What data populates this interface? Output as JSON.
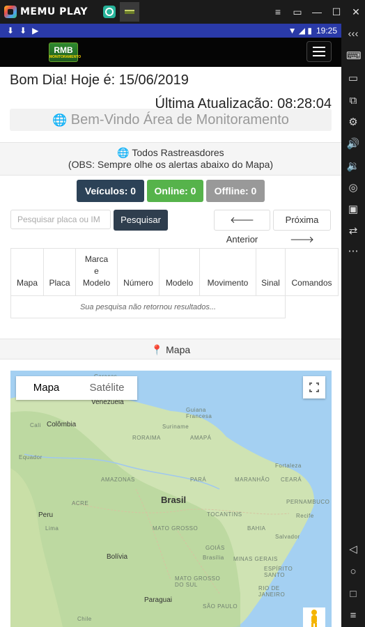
{
  "emulator": {
    "brand": "MEMU PLAY",
    "window_controls": [
      "≡",
      "▭",
      "—",
      "☐",
      "✕"
    ],
    "side_icons": [
      "expand-icon",
      "keyboard-icon",
      "screen-icon",
      "copy-icon",
      "settings-icon",
      "volume-up-icon",
      "volume-down-icon",
      "location-icon",
      "folder-icon",
      "rotate-icon",
      "more-icon",
      "back-icon",
      "home-icon",
      "recents-icon",
      "menu-icon"
    ],
    "side_glyphs": [
      "‹‹‹",
      "⌨",
      "▭",
      "⧉",
      "⚙",
      "🔊",
      "🔉",
      "◎",
      "▣",
      "⇄",
      "⋯",
      "◁",
      "○",
      "□",
      "≡"
    ],
    "side_top": "‹‹‹"
  },
  "statusbar": {
    "left_icons": [
      "⬇",
      "⬇",
      "▶"
    ],
    "time": "19:25",
    "icons": "▼ ◢ ▮"
  },
  "app": {
    "logo": "RMB",
    "logo_sub": "MONITORAMENTO"
  },
  "content": {
    "greeting": "Bom Dia! Hoje é: 15/06/2019",
    "last_update": "Última Atualização: 08:28:04",
    "welcome": "Bem-Vindo Área de Monitoramento",
    "panel_title": "Todos Rastreasdores",
    "panel_note": "(OBS: Sempre olhe os alertas abaixo do Mapa)",
    "counters": {
      "vehicles": "Veículos: 0",
      "online": "Online: 0",
      "offline": "Offline: 0"
    },
    "search_placeholder": "Pesquisar placa ou IM",
    "search_button": "Pesquisar",
    "prev_button": "Anterior",
    "next_button": "Próxima",
    "table_headers": [
      "Mapa",
      "Placa",
      "Marca\ne\nModelo",
      "Número",
      "Modelo",
      "Movimento",
      "Sinal",
      "Comandos"
    ],
    "empty_message": "Sua pesquisa não retornou resultados...",
    "map_section": "Mapa"
  },
  "map": {
    "tab_map": "Mapa",
    "tab_satellite": "Satélite",
    "labels": {
      "caracas": "Caracas",
      "venezuela": "Venezuela",
      "guiana": "Guiana\nFrancesa",
      "cali": "Cali",
      "colombia": "Colômbia",
      "suriname": "Suriname",
      "amapa": "AMAPÁ",
      "roraima": "RORAIMA",
      "equador": "Equador",
      "fortaleza": "Fortaleza",
      "amazonas": "AMAZONAS",
      "para": "PARÁ",
      "maranhao": "MARANHÃO",
      "ceara": "CEARÁ",
      "brasil": "Brasil",
      "acre": "ACRE",
      "pernambuco": "PERNAMBUCO",
      "peru": "Peru",
      "lima": "Lima",
      "tocantins": "TOCANTINS",
      "recife": "Recife",
      "matogrosso": "MATO GROSSO",
      "bahia": "BAHIA",
      "salvador": "Salvador",
      "bolivia": "Bolívia",
      "goias": "GOIÁS",
      "brasilia": "Brasília",
      "minas": "MINAS GERAIS",
      "ms": "MATO GROSSO\nDO SUL",
      "espirito": "ESPÍRITO\nSANTO",
      "riojaneiro": "RIO DE\nJANEIRO",
      "paraguay": "Paraguai",
      "saopaulo": "SÃO PAULO",
      "chile": "Chile"
    }
  },
  "colors": {
    "vehicles": "#2c4257",
    "online": "#56b34b",
    "offline": "#999999",
    "search_button": "#2f3e4e",
    "statusbar": "#2a3aa8"
  }
}
